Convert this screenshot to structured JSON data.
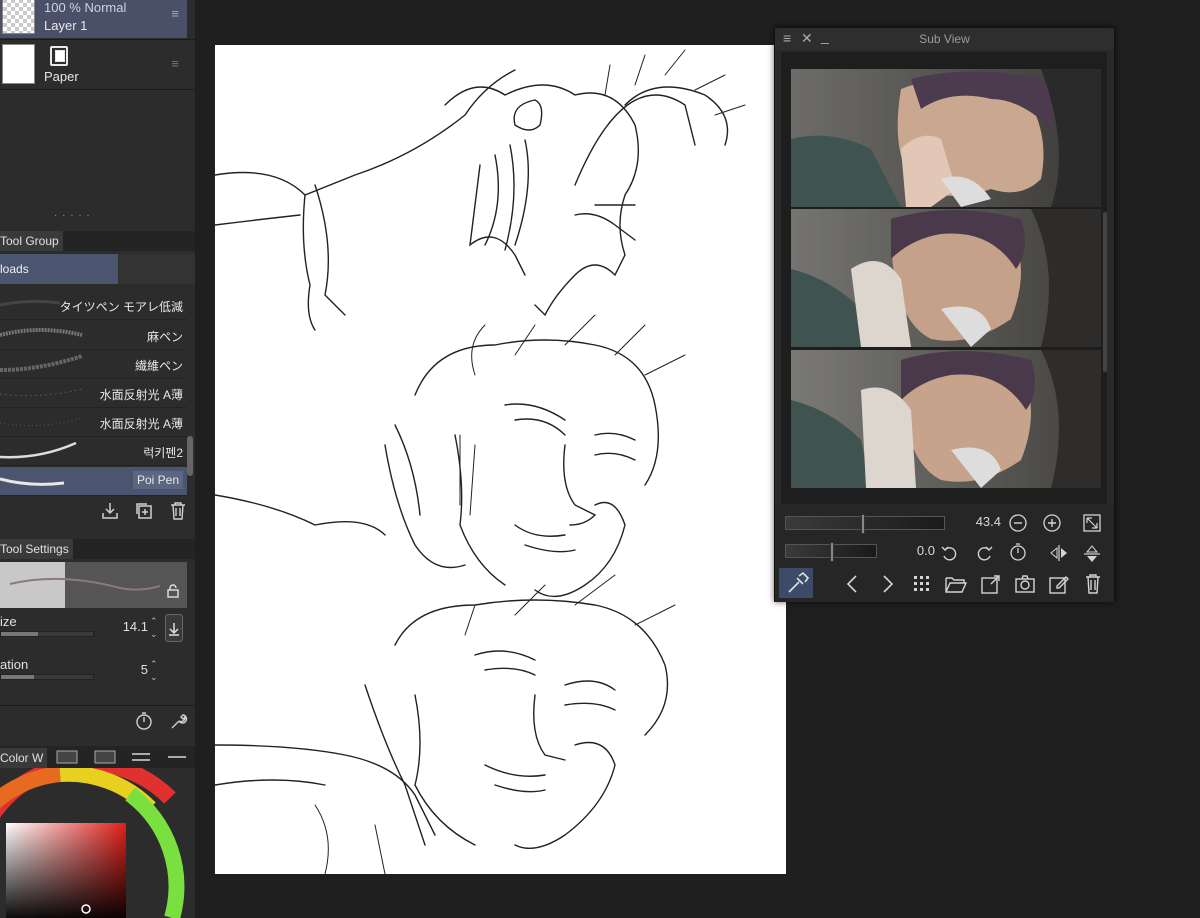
{
  "layers": [
    {
      "info": "100 %  Normal",
      "name": "Layer 1",
      "selected": true
    },
    {
      "name": "Paper",
      "selected": false
    }
  ],
  "tool_group": {
    "tab_label": "Tool Group",
    "active_group": "loads"
  },
  "brushes": [
    {
      "name": "タイツペン モアレ低減",
      "selected": false
    },
    {
      "name": "麻ペン",
      "selected": false
    },
    {
      "name": "繊維ペン",
      "selected": false
    },
    {
      "name": "水面反射光 A薄",
      "selected": false
    },
    {
      "name": "水面反射光 A薄",
      "selected": false
    },
    {
      "name": "럭키펜2",
      "selected": false
    },
    {
      "name": "Poi Pen",
      "selected": true
    }
  ],
  "tool_settings": {
    "tab_label": "Tool Settings",
    "size_label": "ize",
    "size_value": "14.1",
    "stabilization_label": "ation",
    "stabilization_value": "5"
  },
  "color_panel": {
    "tab_label": "Color W"
  },
  "subview": {
    "title": "Sub View",
    "zoom_value": "43.4",
    "rotation_value": "0.0"
  },
  "icons": {
    "layer_menu": "hamburger-icon",
    "import": "import-icon",
    "duplicate": "duplicate-icon",
    "delete": "trash-icon",
    "lock": "lock-icon",
    "download": "download-icon",
    "timer": "timer-icon",
    "wrench": "wrench-icon",
    "eyedropper": "eyedropper-icon",
    "prev": "chevron-left-icon",
    "next": "chevron-right-icon",
    "grid": "grid-icon",
    "open_folder": "folder-open-icon",
    "import_image": "import-image-icon",
    "camera": "camera-icon",
    "edit": "edit-icon",
    "fit": "fit-icon",
    "zoom_out": "zoom-out-icon",
    "zoom_in": "zoom-in-icon",
    "rotate_left": "rotate-left-icon",
    "rotate_right": "rotate-right-icon",
    "reset_rotation": "reset-rotation-icon",
    "flip_horizontal": "flip-horizontal-icon",
    "flip_vertical": "flip-vertical-icon"
  },
  "colors": {
    "selection": "#4c556f",
    "panel": "#2c2c2c",
    "background": "#1f1f1f",
    "canvas": "#ffffff"
  }
}
